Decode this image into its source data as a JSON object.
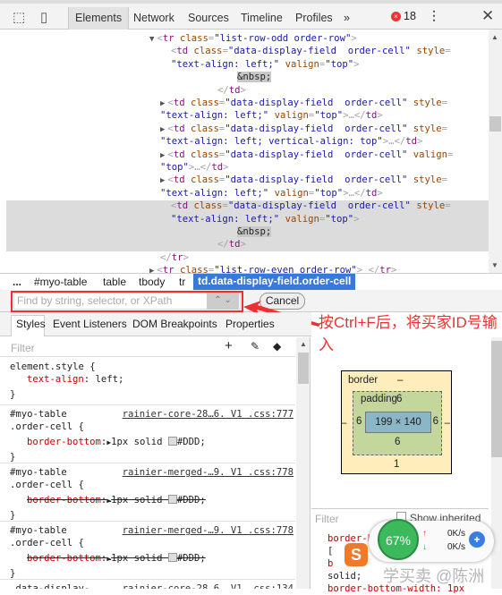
{
  "toolbar": {
    "tabs": [
      "Elements",
      "Network",
      "Sources",
      "Timeline",
      "Profiles"
    ],
    "more": "»",
    "error_count": "18"
  },
  "dom": [
    [
      [
        "tri",
        "▼"
      ],
      [
        "p",
        "<"
      ],
      [
        "t",
        "tr"
      ],
      [
        "a",
        " class"
      ],
      [
        "p",
        "="
      ],
      [
        "v",
        "\"list-row-odd order-row\""
      ],
      [
        "p",
        ">"
      ]
    ],
    [
      [
        "p",
        "<"
      ],
      [
        "t",
        "td"
      ],
      [
        "a",
        " class"
      ],
      [
        "p",
        "="
      ],
      [
        "v",
        "\"data-display-field  order-cell\""
      ],
      [
        "a",
        " style"
      ],
      [
        "p",
        "="
      ]
    ],
    [
      [
        "v",
        "\"text-align: left;\""
      ],
      [
        "a",
        " valign"
      ],
      [
        "p",
        "="
      ],
      [
        "v",
        "\"top\""
      ],
      [
        "p",
        ">"
      ]
    ],
    [
      [
        "n",
        "&nbsp;"
      ]
    ],
    [
      [
        "p",
        "</"
      ],
      [
        "t",
        "td"
      ],
      [
        "p",
        ">"
      ]
    ],
    [
      [
        "tri",
        "▶"
      ],
      [
        "p",
        "<"
      ],
      [
        "t",
        "td"
      ],
      [
        "a",
        " class"
      ],
      [
        "p",
        "="
      ],
      [
        "v",
        "\"data-display-field  order-cell\""
      ],
      [
        "a",
        " style"
      ],
      [
        "p",
        "="
      ]
    ],
    [
      [
        "v",
        "\"text-align: left;\""
      ],
      [
        "a",
        " valign"
      ],
      [
        "p",
        "="
      ],
      [
        "v",
        "\"top\""
      ],
      [
        "p",
        ">…</"
      ],
      [
        "t",
        "td"
      ],
      [
        "p",
        ">"
      ]
    ],
    [
      [
        "tri",
        "▶"
      ],
      [
        "p",
        "<"
      ],
      [
        "t",
        "td"
      ],
      [
        "a",
        " class"
      ],
      [
        "p",
        "="
      ],
      [
        "v",
        "\"data-display-field  order-cell\""
      ],
      [
        "a",
        " style"
      ],
      [
        "p",
        "="
      ]
    ],
    [
      [
        "v",
        "\"text-align: left; vertical-align: top\""
      ],
      [
        "p",
        ">…</"
      ],
      [
        "t",
        "td"
      ],
      [
        "p",
        ">"
      ]
    ],
    [
      [
        "tri",
        "▶"
      ],
      [
        "p",
        "<"
      ],
      [
        "t",
        "td"
      ],
      [
        "a",
        " class"
      ],
      [
        "p",
        "="
      ],
      [
        "v",
        "\"data-display-field  order-cell\""
      ],
      [
        "a",
        " valign"
      ],
      [
        "p",
        "="
      ]
    ],
    [
      [
        "v",
        "\"top\""
      ],
      [
        "p",
        ">…</"
      ],
      [
        "t",
        "td"
      ],
      [
        "p",
        ">"
      ]
    ],
    [
      [
        "tri",
        "▶"
      ],
      [
        "p",
        "<"
      ],
      [
        "t",
        "td"
      ],
      [
        "a",
        " class"
      ],
      [
        "p",
        "="
      ],
      [
        "v",
        "\"data-display-field  order-cell\""
      ],
      [
        "a",
        " style"
      ],
      [
        "p",
        "="
      ]
    ],
    [
      [
        "v",
        "\"text-align: left;\""
      ],
      [
        "a",
        " valign"
      ],
      [
        "p",
        "="
      ],
      [
        "v",
        "\"top\""
      ],
      [
        "p",
        ">…</"
      ],
      [
        "t",
        "td"
      ],
      [
        "p",
        ">"
      ]
    ],
    [
      [
        "p",
        "<"
      ],
      [
        "t",
        "td"
      ],
      [
        "a",
        " class"
      ],
      [
        "p",
        "="
      ],
      [
        "v",
        "\"data-display-field  order-cell\""
      ],
      [
        "a",
        " style"
      ],
      [
        "p",
        "="
      ]
    ],
    [
      [
        "v",
        "\"text-align: left;\""
      ],
      [
        "a",
        " valign"
      ],
      [
        "p",
        "="
      ],
      [
        "v",
        "\"top\""
      ],
      [
        "p",
        ">"
      ]
    ],
    [
      [
        "n",
        "&nbsp;"
      ]
    ],
    [
      [
        "p",
        "</"
      ],
      [
        "t",
        "td"
      ],
      [
        "p",
        ">"
      ]
    ],
    [
      [
        "p",
        "</"
      ],
      [
        "t",
        "tr"
      ],
      [
        "p",
        ">"
      ]
    ],
    [
      [
        "tri",
        "▶"
      ],
      [
        "p",
        "<"
      ],
      [
        "t",
        "tr"
      ],
      [
        "a",
        " class"
      ],
      [
        "p",
        "="
      ],
      [
        "v",
        "\"list-row-even order-row\""
      ],
      [
        "p",
        "> </"
      ],
      [
        "t",
        "tr"
      ],
      [
        "p",
        ">"
      ]
    ]
  ],
  "breadcrumbs": [
    "...",
    "#myo-table",
    "table",
    "tbody",
    "tr",
    "td.data-display-field.order-cell"
  ],
  "search": {
    "placeholder": "Find by string, selector, or XPath",
    "up": "⌃",
    "down": "⌄",
    "cancel": "Cancel"
  },
  "annotation": "按Ctrl+F后，将买家ID号输入",
  "annotation_color": "#f03030",
  "style_tabs": [
    "Styles",
    "Event Listeners",
    "DOM Breakpoints",
    "Properties"
  ],
  "filter_placeholder": "Filter",
  "rules": [
    {
      "selector": "element.style {",
      "selector2": "",
      "source": "",
      "prop": "text-align",
      "value": " left;",
      "swatch": false,
      "struck": false
    },
    {
      "selector": "#myo-table",
      "selector2": ".order-cell {",
      "source": "rainier-core-28…6. V1 .css:777",
      "prop": "border-bottom",
      "value": "1px solid ",
      "color": "#DDD;",
      "swatch": true,
      "struck": false
    },
    {
      "selector": "#myo-table",
      "selector2": ".order-cell {",
      "source": "rainier-merged-…9. V1 .css:778",
      "prop": "border-bottom",
      "value": "1px solid ",
      "color": "#DDD;",
      "swatch": true,
      "struck": true
    },
    {
      "selector": "#myo-table",
      "selector2": ".order-cell {",
      "source": "rainier-merged-…9. V1 .css:778",
      "prop": "border-bottom",
      "value": "1px solid ",
      "color": "#DDD;",
      "swatch": true,
      "struck": true
    },
    {
      "selector": ".data-display-",
      "selector2": "",
      "source": "rainier-core-28…6. V1 .css:134",
      "prop": "",
      "value": "",
      "swatch": false,
      "struck": false
    }
  ],
  "boxmodel": {
    "border_label": "border",
    "border_value": "–",
    "padding_label": "padding",
    "padding_top": "6",
    "padding_left": "6",
    "padding_right": "6",
    "padding_bottom": "6",
    "margin_left": "–",
    "margin_right": "–",
    "border_bottom": "1",
    "content": "199 × 140"
  },
  "computed": {
    "filter": "Filter",
    "show_inherited": "Show inherited",
    "lines": [
      "border-bo",
      "[",
      "b",
      "solid;",
      "border-bottom-width: 1px"
    ]
  },
  "widget": {
    "percent": "67%",
    "up": "0K/s",
    "down": "0K/s"
  },
  "watermark": "学买卖 @陈洲"
}
